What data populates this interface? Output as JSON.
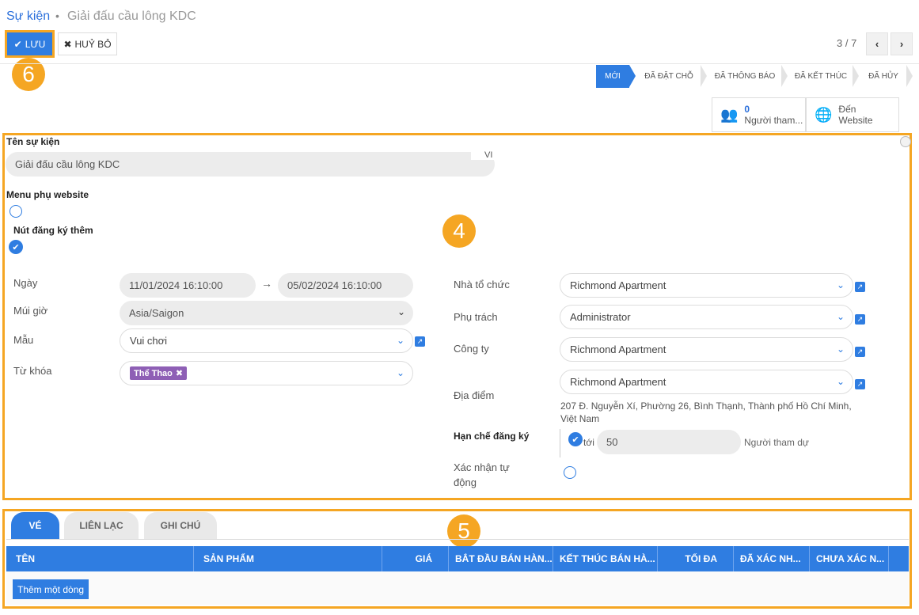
{
  "breadcrumb": {
    "parent": "Sự kiện",
    "separator": "•",
    "current": "Giải đấu cầu lông KDC"
  },
  "toolbar": {
    "save_label": "LƯU",
    "cancel_label": "HUỶ BỎ",
    "pager": "3 / 7"
  },
  "badges": {
    "save": "6",
    "form": "4",
    "tabs": "5"
  },
  "status_bar": {
    "stages": [
      "MỚI",
      "ĐÃ ĐẶT CHỖ",
      "ĐÃ THÔNG BÁO",
      "ĐÃ KẾT THÚC",
      "ĐÃ HỦY"
    ],
    "active": "MỚI"
  },
  "smart_buttons": {
    "attendees_count": "0",
    "attendees_label": "Người tham...",
    "website_line1": "Đến",
    "website_line2": "Website"
  },
  "form": {
    "name_label": "Tên sự kiện",
    "name_value": "Giải đấu cầu lông KDC",
    "lang": "VI",
    "website_menu_label": "Menu phụ website",
    "register_button_label": "Nút đăng ký thêm",
    "date_label": "Ngày",
    "date_start": "11/01/2024 16:10:00",
    "date_arrow": "→",
    "date_end": "05/02/2024 16:10:00",
    "timezone_label": "Múi giờ",
    "timezone_value": "Asia/Saigon",
    "template_label": "Mẫu",
    "template_value": "Vui chơi",
    "tags_label": "Từ khóa",
    "tag_value": "Thể Thao",
    "organizer_label": "Nhà tổ chức",
    "organizer_value": "Richmond Apartment",
    "responsible_label": "Phụ trách",
    "responsible_value": "Administrator",
    "company_label": "Công ty",
    "company_value": "Richmond Apartment",
    "venue_label": "Địa điểm",
    "venue_value": "Richmond Apartment",
    "venue_address_1": "207 Đ. Nguyễn Xí, Phường 26, Bình Thạnh, Thành phố Hồ Chí Minh,",
    "venue_address_2": "Việt Nam",
    "limit_label": "Hạn chế đăng ký",
    "limit_to": "tới",
    "limit_value": "50",
    "limit_unit": "Người tham dự",
    "autoconfirm_label_1": "Xác nhận tự",
    "autoconfirm_label_2": "động"
  },
  "tabs": [
    "VÉ",
    "LIÊN LẠC",
    "GHI CHÚ"
  ],
  "table": {
    "headers": [
      "TÊN",
      "SẢN PHẨM",
      "GIÁ",
      "BẮT ĐẦU BÁN HÀN...",
      "KẾT THÚC BÁN HÀ...",
      "TỐI ĐA",
      "ĐÃ XÁC NH...",
      "CHƯA XÁC N..."
    ],
    "add_line": "Thêm một dòng"
  },
  "colors": {
    "accent": "#2f7de1",
    "highlight": "#f5a623",
    "tag": "#8e5fb5"
  }
}
